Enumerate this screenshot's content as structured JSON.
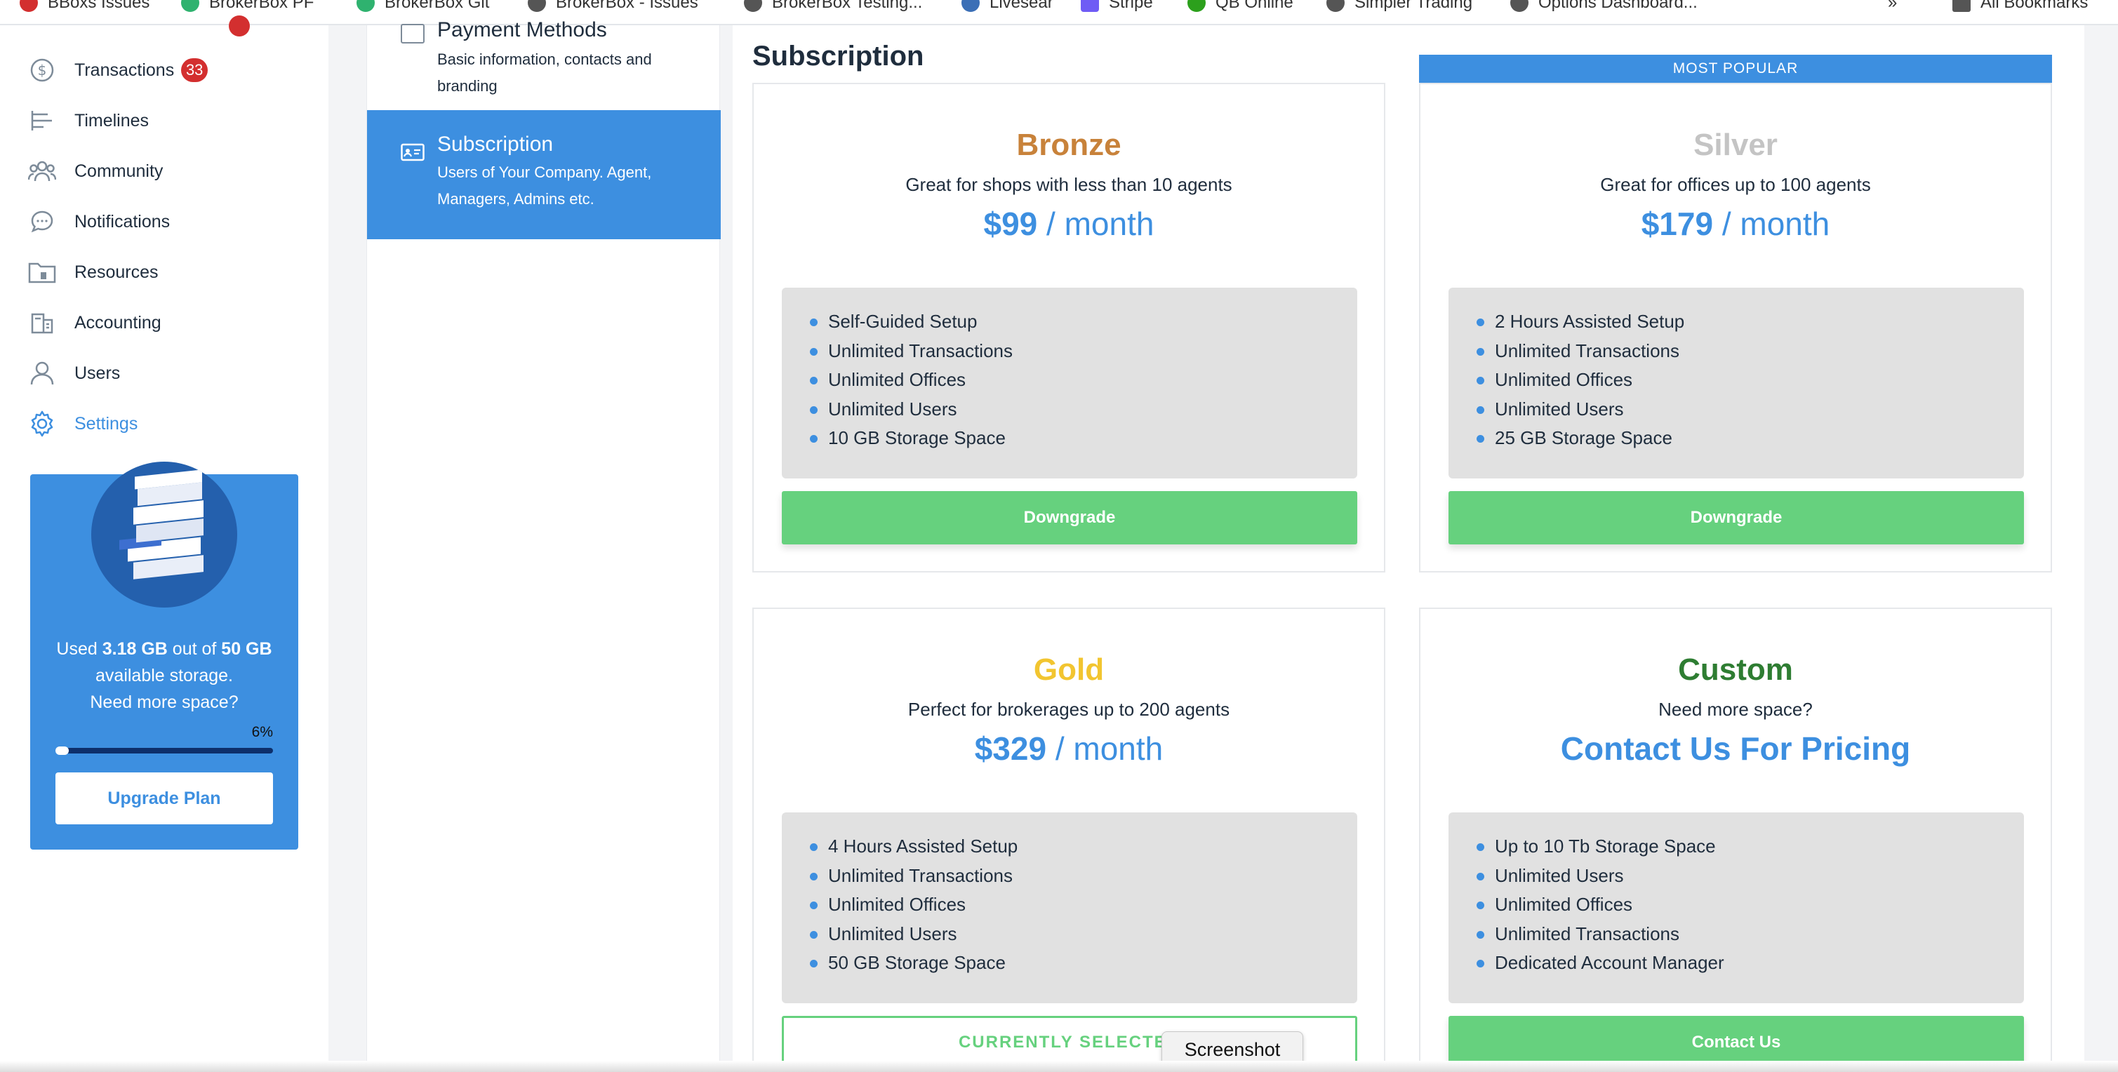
{
  "bookmarks": [
    {
      "label": "BBoxs Issues",
      "icon": "shield-icon",
      "color": "#d32f2f"
    },
    {
      "label": "BrokerBox PF",
      "icon": "vue-icon",
      "color": "#2fb26f"
    },
    {
      "label": "BrokerBox Git",
      "icon": "vue-icon",
      "color": "#2fb26f"
    },
    {
      "label": "BrokerBox - Issues",
      "icon": "github-icon",
      "color": "#555555"
    },
    {
      "label": "BrokerBox Testing...",
      "icon": "github-icon",
      "color": "#555555"
    },
    {
      "label": "Livesear",
      "icon": "wordpress-icon",
      "color": "#3b6fb6"
    },
    {
      "label": "Stripe",
      "icon": "stripe-icon",
      "color": "#6f5cf5"
    },
    {
      "label": "QB Online",
      "icon": "qb-icon",
      "color": "#2ca01c"
    },
    {
      "label": "Simpler Trading",
      "icon": "github-icon",
      "color": "#555555"
    },
    {
      "label": "Options Dashboard...",
      "icon": "github-icon",
      "color": "#555555"
    },
    {
      "label": "All Bookmarks",
      "icon": "folder-icon",
      "color": "#555555"
    }
  ],
  "sidebar": {
    "items": [
      {
        "label": "Transactions",
        "badge": "33",
        "icon": "dollar-icon"
      },
      {
        "label": "Timelines",
        "icon": "timeline-icon"
      },
      {
        "label": "Community",
        "icon": "community-icon"
      },
      {
        "label": "Notifications",
        "icon": "chat-bubble-icon"
      },
      {
        "label": "Resources",
        "icon": "folder-icon"
      },
      {
        "label": "Accounting",
        "icon": "accounting-icon"
      },
      {
        "label": "Users",
        "icon": "user-icon"
      },
      {
        "label": "Settings",
        "icon": "gear-icon",
        "active": true
      }
    ],
    "storage": {
      "used_prefix": "Used ",
      "used_value": "3.18 GB",
      "used_mid": " out of ",
      "total_value": "50 GB",
      "used_suffix": " available storage.",
      "need_more": "Need more space?",
      "percent_label": "6%",
      "percent": 6,
      "upgrade_label": "Upgrade Plan"
    }
  },
  "settings_menu": {
    "items": [
      {
        "title": "Payment Methods",
        "desc": "Basic information, contacts and branding"
      },
      {
        "title": "Subscription",
        "desc": "Users of Your Company. Agent, Managers, Admins etc.",
        "active": true
      }
    ]
  },
  "main": {
    "title": "Subscription",
    "ribbon": "MOST POPULAR",
    "plans": [
      {
        "name": "Bronze",
        "color": "#c8823a",
        "subtitle": "Great for shops with less than 10 agents",
        "price": "$99",
        "period": " / month",
        "features": [
          "Self-Guided Setup",
          "Unlimited Transactions",
          "Unlimited Offices",
          "Unlimited Users",
          "10 GB Storage Space"
        ],
        "button": "Downgrade"
      },
      {
        "name": "Silver",
        "color": "#c4c4c4",
        "subtitle": "Great for offices up to 100 agents",
        "price": "$179",
        "period": " / month",
        "features": [
          "2 Hours Assisted Setup",
          "Unlimited Transactions",
          "Unlimited Offices",
          "Unlimited Users",
          "25 GB Storage Space"
        ],
        "button": "Downgrade"
      },
      {
        "name": "Gold",
        "color": "#f2c530",
        "subtitle": "Perfect for brokerages up to 200 agents",
        "price": "$329",
        "period": " / month",
        "features": [
          "4 Hours Assisted Setup",
          "Unlimited Transactions",
          "Unlimited Offices",
          "Unlimited Users",
          "50 GB Storage Space"
        ],
        "button": "CURRENTLY SELECTED"
      },
      {
        "name": "Custom",
        "color": "#2e7d32",
        "subtitle": "Need more space?",
        "contact_heading": "Contact Us For Pricing",
        "features": [
          "Up to 10 Tb Storage Space",
          "Unlimited Users",
          "Unlimited Offices",
          "Unlimited Transactions",
          "Dedicated Account Manager"
        ],
        "button": "Contact Us"
      }
    ]
  },
  "tooltip": "Screenshot",
  "colors": {
    "accent": "#3d8fe0",
    "button_green": "#66d17e",
    "badge_red": "#d32f2f"
  }
}
